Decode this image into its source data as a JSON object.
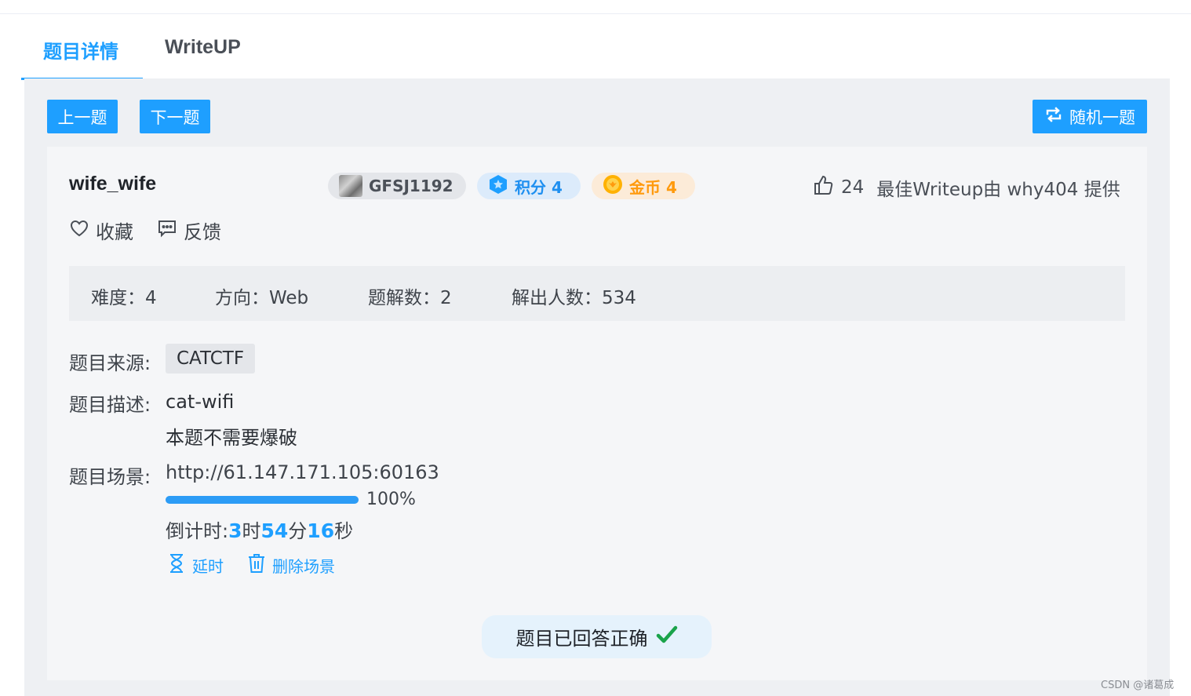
{
  "tabs": [
    {
      "label": "题目详情",
      "active": true
    },
    {
      "label": "WriteUP",
      "active": false
    }
  ],
  "toolbar": {
    "prev_label": "上一题",
    "next_label": "下一题",
    "random_label": "随机一题",
    "random_icon": "repeat-icon"
  },
  "challenge": {
    "title": "wife_wife",
    "author": "GFSJ1192",
    "score_label": "积分 4",
    "coin_label": "金币 4",
    "likes": "24",
    "best_writeup": "最佳Writeup由 why404 提供",
    "favorite_label": "收藏",
    "feedback_label": "反馈"
  },
  "stats": {
    "difficulty": "难度：4",
    "direction": "方向：Web",
    "writeups": "题解数：2",
    "solvers": "解出人数：534"
  },
  "details": {
    "source_label": "题目来源:",
    "source_value": "CATCTF",
    "desc_label": "题目描述:",
    "desc_line1": "cat-wifi",
    "desc_line2": "本题不需要爆破",
    "scene_label": "题目场景:",
    "scene_url": "http://61.147.171.105:60163",
    "progress_percent": 100,
    "progress_text": "100%",
    "countdown_prefix": "倒计时: ",
    "countdown_hours": "3",
    "countdown_h_unit": "时",
    "countdown_minutes": "54",
    "countdown_m_unit": "分",
    "countdown_seconds": "16",
    "countdown_s_unit": "秒",
    "extend_label": "延时",
    "delete_label": "删除场景"
  },
  "status": {
    "answered_label": "题目已回答正确"
  },
  "watermark": "CSDN @诸葛成",
  "colors": {
    "accent": "#1e9fff",
    "success": "#1aa34a",
    "coin": "#ff9a0d"
  }
}
